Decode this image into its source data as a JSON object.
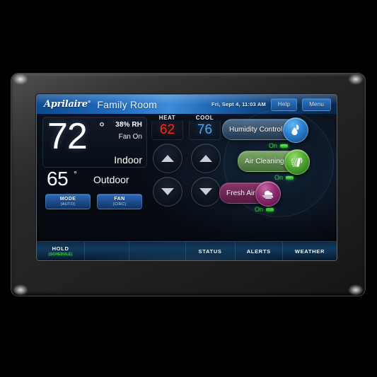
{
  "device": {
    "brand": "Aprilaire",
    "brand_mark": "®"
  },
  "titlebar": {
    "room_name": "Family Room",
    "datetime": "Fri, Sept 4, 11:03 AM",
    "help_label": "Help",
    "menu_label": "Menu"
  },
  "indoor": {
    "temperature": "72",
    "degree": "°",
    "humidity": "38% RH",
    "fan_status": "Fan On",
    "label": "Indoor"
  },
  "outdoor": {
    "temperature": "65",
    "degree": "°",
    "label": "Outdoor"
  },
  "mode_buttons": [
    {
      "label": "MODE",
      "sub": "(AUTO)"
    },
    {
      "label": "FAN",
      "sub": "(CIRC)"
    }
  ],
  "setpoints": [
    {
      "head": "HEAT",
      "value": "62",
      "color": "#ef2b22"
    },
    {
      "head": "COOL",
      "value": "76",
      "color": "#4fa6e8"
    }
  ],
  "steppers": [
    {
      "name": "heat-up",
      "glyph": "up"
    },
    {
      "name": "cool-up",
      "glyph": "up"
    },
    {
      "name": "heat-down",
      "glyph": "down"
    },
    {
      "name": "cool-down",
      "glyph": "down"
    }
  ],
  "controls": [
    {
      "id": "humidity-control",
      "label": "Humidity Control",
      "status": "On",
      "icon": "humidity-droplet-flame-icon",
      "color": "#2c7fd0"
    },
    {
      "id": "air-cleaning",
      "label": "Air Cleaning",
      "status": "On",
      "icon": "air-filter-icon",
      "color": "#4fa930"
    },
    {
      "id": "fresh-air",
      "label": "Fresh Air",
      "status": "On",
      "icon": "fresh-air-cloud-icon",
      "color": "#8d2a6c"
    }
  ],
  "tabs": [
    {
      "id": "hold",
      "label": "HOLD",
      "sub": "(SCHEDULE)"
    },
    {
      "id": "status",
      "label": "STATUS",
      "sub": ""
    },
    {
      "id": "alerts",
      "label": "ALERTS",
      "sub": ""
    },
    {
      "id": "weather",
      "label": "WEATHER",
      "sub": ""
    }
  ],
  "colors": {
    "accent_blue": "#1d6cc0",
    "heat_red": "#ef2b22",
    "cool_blue": "#4fa6e8",
    "status_green": "#3fd13f"
  }
}
